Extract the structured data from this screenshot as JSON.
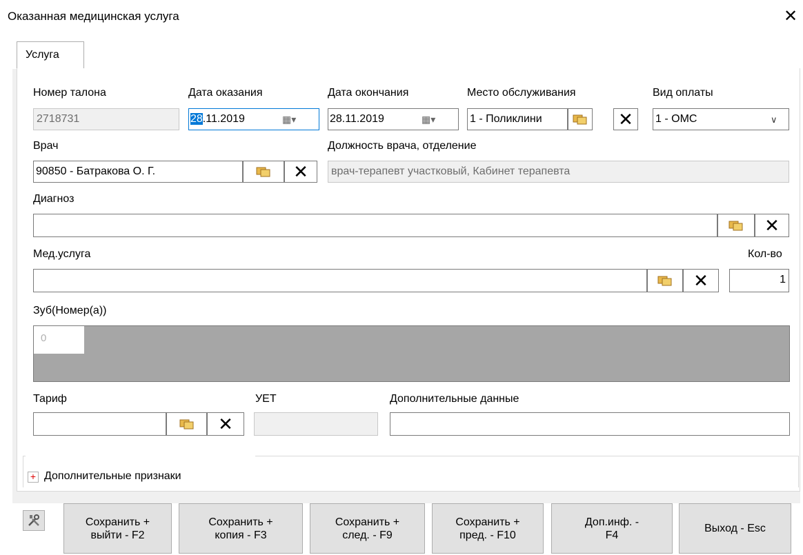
{
  "window": {
    "title": "Оказанная медицинская услуга",
    "close": "✕"
  },
  "tab": {
    "label": "Услуга"
  },
  "labels": {
    "nomer_talona": "Номер талона",
    "data_okazaniya": "Дата оказания",
    "data_okonchaniya": "Дата окончания",
    "mesto": "Место обслуживания",
    "vid_oplaty": "Вид оплаты",
    "vrach": "Врач",
    "dolzhnost": "Должность врача, отделение",
    "diagnoz": "Диагноз",
    "med_usluga": "Мед.услуга",
    "kol_vo": "Кол-во",
    "zub": "Зуб(Номер(а))",
    "tarif": "Тариф",
    "uet": "УЕТ",
    "dop_dannye": "Дополнительные данные",
    "dop_priznaki": "Дополнительные признаки"
  },
  "values": {
    "nomer_talona": "2718731",
    "data_okazaniya_sel": "28",
    "data_okazaniya_rest": ".11.2019",
    "data_okonchaniya": "28.11.2019",
    "mesto": "1 - Поликлини",
    "vid_oplaty": "1 - ОМС",
    "vrach": "90850 - Батракова О. Г.",
    "dolzhnost": "врач-терапевт участковый, Кабинет терапевта",
    "diagnoz": "",
    "med_usluga": "",
    "kol_vo": "1",
    "zub": "0",
    "tarif": "",
    "uet": "",
    "dop_dannye": ""
  },
  "buttons": {
    "save_exit_1": "Сохранить +",
    "save_exit_2": "выйти - F2",
    "save_copy_1": "Сохранить +",
    "save_copy_2": "копия - F3",
    "save_next_1": "Сохранить +",
    "save_next_2": "след. - F9",
    "save_prev_1": "Сохранить +",
    "save_prev_2": "пред. - F10",
    "dop_inf_1": "Доп.инф. -",
    "dop_inf_2": "F4",
    "exit": "Выход - Esc"
  },
  "icons": {
    "calendar": "calendar-icon",
    "select": "folders-icon",
    "clear": "clear-icon",
    "dropdown": "chevron-down-icon",
    "expand": "plus-icon",
    "tools": "tools-icon"
  }
}
